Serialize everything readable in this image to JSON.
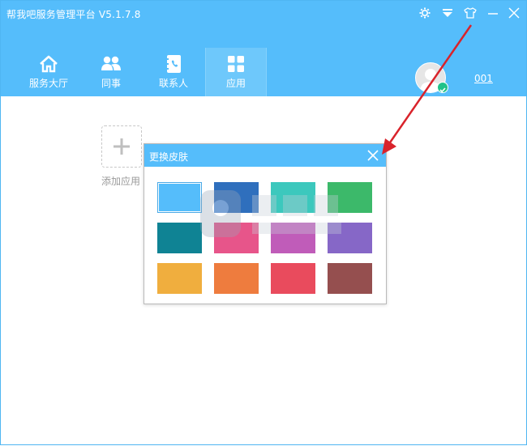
{
  "app": {
    "title": "帮我吧服务管理平台  V5.1.7.8"
  },
  "window_controls": [
    {
      "name": "settings-icon"
    },
    {
      "name": "dropdown-icon"
    },
    {
      "name": "skin-icon"
    },
    {
      "name": "minimize-icon"
    },
    {
      "name": "close-icon"
    }
  ],
  "nav": [
    {
      "label": "服务大厅",
      "icon": "home-icon"
    },
    {
      "label": "同事",
      "icon": "colleagues-icon"
    },
    {
      "label": "联系人",
      "icon": "contacts-icon"
    },
    {
      "label": "应用",
      "icon": "apps-icon",
      "active": true
    }
  ],
  "user": {
    "name": "001"
  },
  "main": {
    "add_app_label": "添加应用"
  },
  "skin_dialog": {
    "title": "更换皮肤",
    "swatches": [
      "#55bdfb",
      "#2f6fbd",
      "#3cc8bd",
      "#3cb96a",
      "#0f8394",
      "#e7558a",
      "#c05cb9",
      "#8667c7",
      "#f0ae3e",
      "#ee7c3e",
      "#e94b5d",
      "#954f4f"
    ],
    "selected_index": 0
  },
  "colors": {
    "accent": "#55bdfb",
    "annotation_arrow": "#d9232b"
  }
}
